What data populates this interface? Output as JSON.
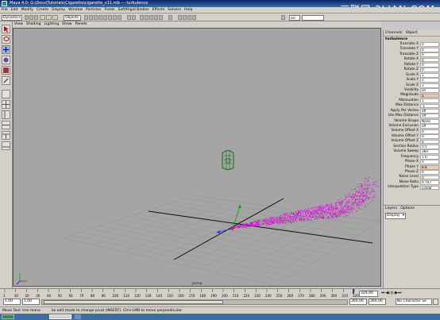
{
  "window": {
    "title": "Maya 4.0: G:\\Docs\\Tutorials\\Cigarette\\cigarette_v11.mb  ---  turbulence"
  },
  "watermark": "三联网 3LIAN.COM",
  "menubar": {
    "items": [
      "File",
      "Edit",
      "Modify",
      "Create",
      "Display",
      "Window",
      "Particles",
      "Fields",
      "Soft/Rigid Bodies",
      "Effects",
      "Solvers",
      "Help"
    ]
  },
  "shelf": {
    "mode": "Dynamics",
    "selection_mask": "Objects",
    "selection_field": "sel"
  },
  "viewport": {
    "menu": [
      "View",
      "Shading",
      "Lighting",
      "Show",
      "Panels"
    ],
    "camera_label": "persp"
  },
  "channel_box": {
    "tabs": [
      "Channels",
      "Object"
    ],
    "object_name": "turbulence",
    "attributes": [
      {
        "label": "Translate X",
        "value": "0"
      },
      {
        "label": "Translate Y",
        "value": "0"
      },
      {
        "label": "Translate Z",
        "value": "0"
      },
      {
        "label": "Rotate X",
        "value": "0"
      },
      {
        "label": "Rotate Y",
        "value": "0"
      },
      {
        "label": "Rotate Z",
        "value": "0"
      },
      {
        "label": "Scale X",
        "value": "1"
      },
      {
        "label": "Scale Y",
        "value": "1"
      },
      {
        "label": "Scale Z",
        "value": "1"
      },
      {
        "label": "Visibility",
        "value": "on"
      },
      {
        "label": "Magnitude",
        "value": "5",
        "highlight": true
      },
      {
        "label": "Attenuation",
        "value": "1"
      },
      {
        "label": "Max Distance",
        "value": "-1"
      },
      {
        "label": "Apply Per Vertex",
        "value": "off"
      },
      {
        "label": "Use Max Distance",
        "value": "off"
      },
      {
        "label": "Volume Shape",
        "value": "None"
      },
      {
        "label": "Volume Exclusion",
        "value": "off"
      },
      {
        "label": "Volume Offset X",
        "value": "0"
      },
      {
        "label": "Volume Offset Y",
        "value": "0"
      },
      {
        "label": "Volume Offset Z",
        "value": "0"
      },
      {
        "label": "Section Radius",
        "value": "0.5"
      },
      {
        "label": "Volume Sweep",
        "value": "360"
      },
      {
        "label": "Frequency",
        "value": "1.6"
      },
      {
        "label": "Phase X",
        "value": "0"
      },
      {
        "label": "Phase Y",
        "value": "8.8",
        "highlight": true
      },
      {
        "label": "Phase Z",
        "value": "0"
      },
      {
        "label": "Noise Level",
        "value": "0"
      },
      {
        "label": "Noise Ratio",
        "value": "0.707"
      },
      {
        "label": "Interpolation Type",
        "value": "Linear"
      }
    ]
  },
  "layers": {
    "menu": [
      "Layers",
      "Options"
    ],
    "dropdown": "Display"
  },
  "timeline": {
    "ticks": [
      "1",
      "10",
      "20",
      "30",
      "40",
      "50",
      "60",
      "70",
      "80",
      "90",
      "100",
      "110",
      "120",
      "130",
      "140",
      "150",
      "160",
      "170",
      "180",
      "190",
      "200",
      "210",
      "220",
      "230",
      "240",
      "250",
      "260",
      "270",
      "280",
      "290",
      "300",
      "310",
      "320"
    ],
    "current_frame": "329.00"
  },
  "range": {
    "start": "1.00",
    "playback_start": "1.00",
    "playback_end": "360.00",
    "end": "360.00",
    "character_set": "No Character Se"
  },
  "status": {
    "text": "Move Tool: Use mana          ke edit mode to change pivot (INSERT). Ctrl+LMB to move perpendicular."
  },
  "colors": {
    "particles": "#e000e0",
    "viewport_bg": "#a5a5a5",
    "grid": "#8e8e8e"
  }
}
